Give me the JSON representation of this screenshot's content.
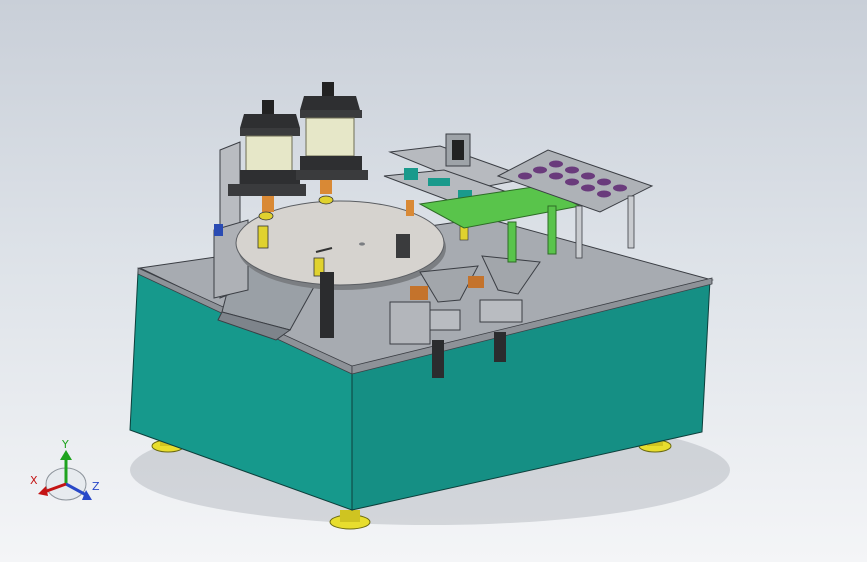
{
  "viewport": {
    "background_top": "#c9cfd8",
    "background_bottom": "#f4f5f7"
  },
  "model": {
    "base_color": "#15968a",
    "top_plate_color": "#a3a7ad",
    "turntable_color": "#d6d3cf",
    "cylinder_body_color": "#e6e7c8",
    "green_conveyor_color": "#59c44b",
    "foot_color": "#e8de2e",
    "part_color_purple": "#6a3b7c"
  },
  "triad": {
    "x_label": "X",
    "y_label": "Y",
    "z_label": "Z",
    "x_color": "#c41414",
    "y_color": "#1ea31e",
    "z_color": "#2848c8"
  }
}
